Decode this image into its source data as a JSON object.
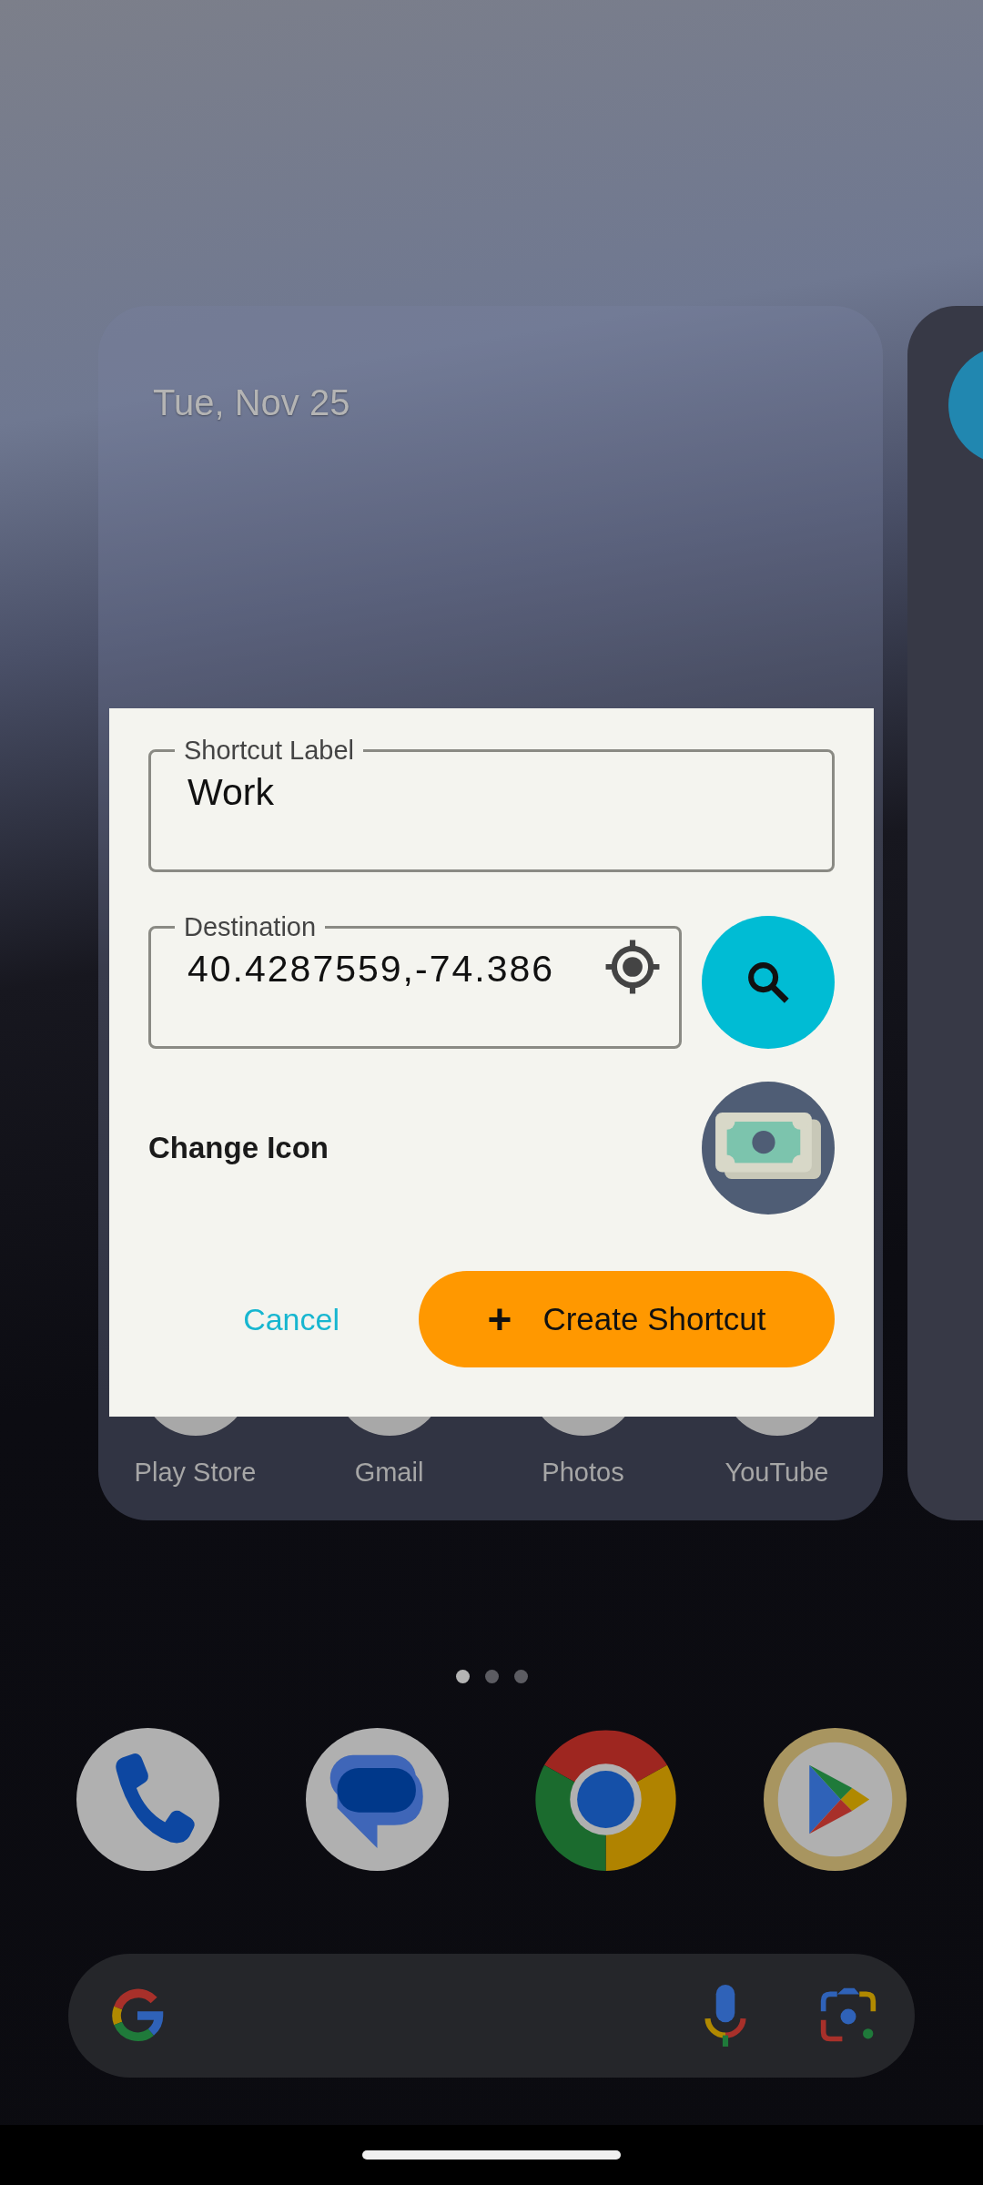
{
  "widget": {
    "date": "Tue, Nov 25"
  },
  "home_apps": [
    {
      "label": "Play Store"
    },
    {
      "label": "Gmail"
    },
    {
      "label": "Photos"
    },
    {
      "label": "YouTube"
    }
  ],
  "dialog": {
    "label_field": {
      "label": "Shortcut Label",
      "value": "Work"
    },
    "destination_field": {
      "label": "Destination",
      "value": "40.4287559,-74.386"
    },
    "change_icon": "Change Icon",
    "cancel": "Cancel",
    "create": {
      "icon": "+",
      "label": "Create Shortcut"
    }
  },
  "page_indicator": [
    {
      "selected": true
    },
    {
      "selected": false
    },
    {
      "selected": false
    }
  ]
}
